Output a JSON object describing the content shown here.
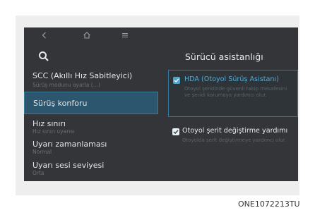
{
  "topbar": {
    "back_icon": "back-icon",
    "home_icon": "home-icon",
    "menu_icon": "menu-icon"
  },
  "search": {
    "icon": "search-icon"
  },
  "menu_items": [
    {
      "label": "SCC (Akıllı Hız Sabitleyici)",
      "sub": "Sürüş modunu ayarla (…)"
    },
    {
      "label": "Sürüş konforu",
      "sub": ""
    },
    {
      "label": "Hız sınırı",
      "sub": "Hız sınırı uyarısı"
    },
    {
      "label": "Uyarı zamanlaması",
      "sub": "Normal"
    },
    {
      "label": "Uyarı sesi seviyesi",
      "sub": "Orta"
    }
  ],
  "right_panel": {
    "title": "Sürücü asistanlığı",
    "options": [
      {
        "title": "HDA (Otoyol Sürüş Asistanı)",
        "desc": "Otoyol şeridinde güvenli takip mesafesini ve şeridi korumaya yardımcı olur.",
        "checked": true
      },
      {
        "title": "Otoyol şerit değiştirme yardımı",
        "desc": "Otoyolda şerit değiştirmeye yardımcı olur.",
        "checked": true
      }
    ]
  },
  "image_code": "ONE1072213TU",
  "colors": {
    "accent": "#2f78a3",
    "selected_bg": "#2b566d",
    "screen_bg": "#333538"
  }
}
